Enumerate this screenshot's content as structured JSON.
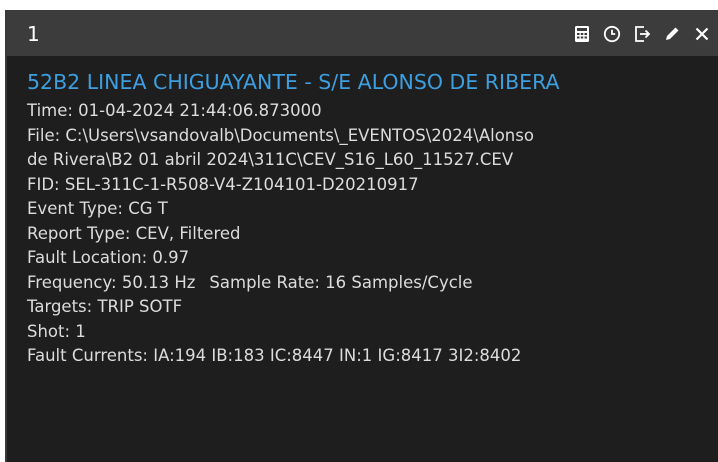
{
  "window": {
    "title": "1",
    "icons": [
      "calculator-icon",
      "clock-icon",
      "export-icon",
      "pencil-icon",
      "close-icon"
    ]
  },
  "event": {
    "title": "52B2 LINEA CHIGUAYANTE - S/E ALONSO DE RIBERA",
    "time": "Time:  01-04-2024 21:44:06.873000",
    "file_line1": "File: C:\\Users\\vsandovalb\\Documents\\_EVENTOS\\2024\\Alonso",
    "file_line2": "de Rivera\\B2 01 abril 2024\\311C\\CEV_S16_L60_11527.CEV",
    "fid": "FID: SEL-311C-1-R508-V4-Z104101-D20210917",
    "event_type": "Event Type: CG T",
    "report_type": "Report Type: CEV, Filtered",
    "fault_location": "Fault Location: 0.97",
    "frequency": "Frequency: 50.13 Hz",
    "sample_rate": "Sample Rate: 16 Samples/Cycle",
    "targets": "Targets: TRIP SOTF",
    "shot": "Shot: 1",
    "fault_currents": "Fault Currents: IA:194 IB:183 IC:8447 IN:1 IG:8417 3I2:8402"
  },
  "colors": {
    "title_blue": "#3d9fe0",
    "text": "#dcdcdc",
    "background": "#1e1e1e",
    "titlebar": "#3c3c3c"
  }
}
